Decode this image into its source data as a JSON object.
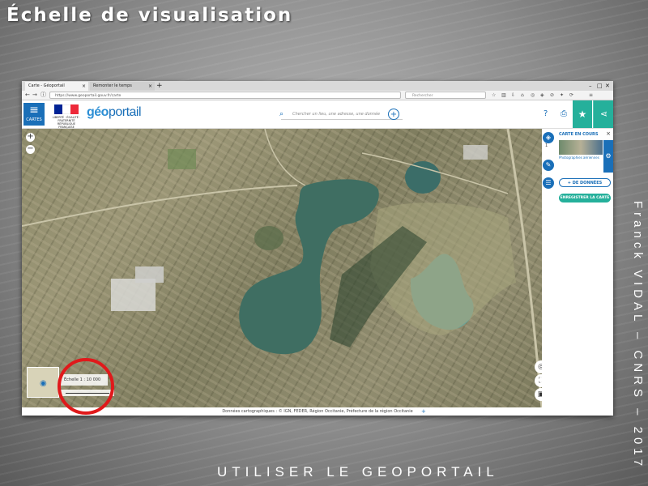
{
  "slide": {
    "title": "Échelle de visualisation",
    "footer": "UTILISER LE GEOPORTAIL",
    "author": "Franck VIDAL – CNRS – 2017"
  },
  "browser": {
    "tabs": [
      {
        "label": "Carte - Géoportail",
        "active": true
      },
      {
        "label": "Remonter le temps",
        "active": false
      }
    ],
    "new_tab": "+",
    "url": "https://www.geoportail.gouv.fr/carte",
    "search_placeholder": "Rechercher",
    "window_controls": {
      "minimize": "–",
      "maximize": "□",
      "close": "✕"
    }
  },
  "geoportail": {
    "menu_label": "CARTES",
    "republic_text": "LIBERTÉ · ÉGALITÉ · FRATERNITÉ RÉPUBLIQUE FRANÇAISE",
    "logo_geo": "géo",
    "logo_portail": "portail",
    "search_placeholder": "Chercher un lieu, une adresse, une donnée",
    "help": "?",
    "current_map_panel": {
      "title": "CARTE EN COURS",
      "layer_count": "1",
      "layer_name": "Photographies aériennes",
      "more_data_label": "+ DE DONNÉES",
      "save_label": "ENREGISTRER LA CARTE"
    },
    "scale_text": "Échelle 1 : 10 000",
    "attribution": "Données cartographiques : © IGN, FEDER, Région Occitanie, Préfecture de la région Occitanie"
  },
  "colors": {
    "brand_blue": "#1a6fb8",
    "accent_teal": "#25b09b",
    "highlight_red": "#e0191b",
    "flag": [
      "#002395",
      "#ffffff",
      "#ed2939"
    ]
  }
}
